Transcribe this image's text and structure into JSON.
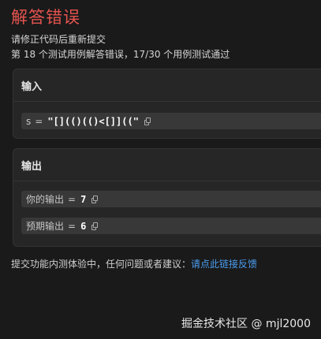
{
  "header": {
    "title": "解答错误",
    "subtitle": "请修正代码后重新提交",
    "summary": "第 18 个测试用例解答错误，17/30 个用例测试通过"
  },
  "input_card": {
    "title": "输入",
    "var_name": "s",
    "eq": "=",
    "value": "\"[](()(()<[]]((\""
  },
  "output_card": {
    "title": "输出",
    "your_output_label": "你的输出",
    "your_output_value": "7",
    "expected_label": "预期输出",
    "expected_value": "6",
    "eq": "="
  },
  "footer": {
    "text": "提交功能内测体验中，任何问题或者建议：",
    "link_text": "请点此链接反馈"
  },
  "watermark": "掘金技术社区 @ mjl2000",
  "colors": {
    "title": "#e6544f",
    "link": "#4b9df0",
    "background": "#1a1a1a",
    "card": "#262626"
  },
  "icons": {
    "copy": "copy-icon"
  }
}
